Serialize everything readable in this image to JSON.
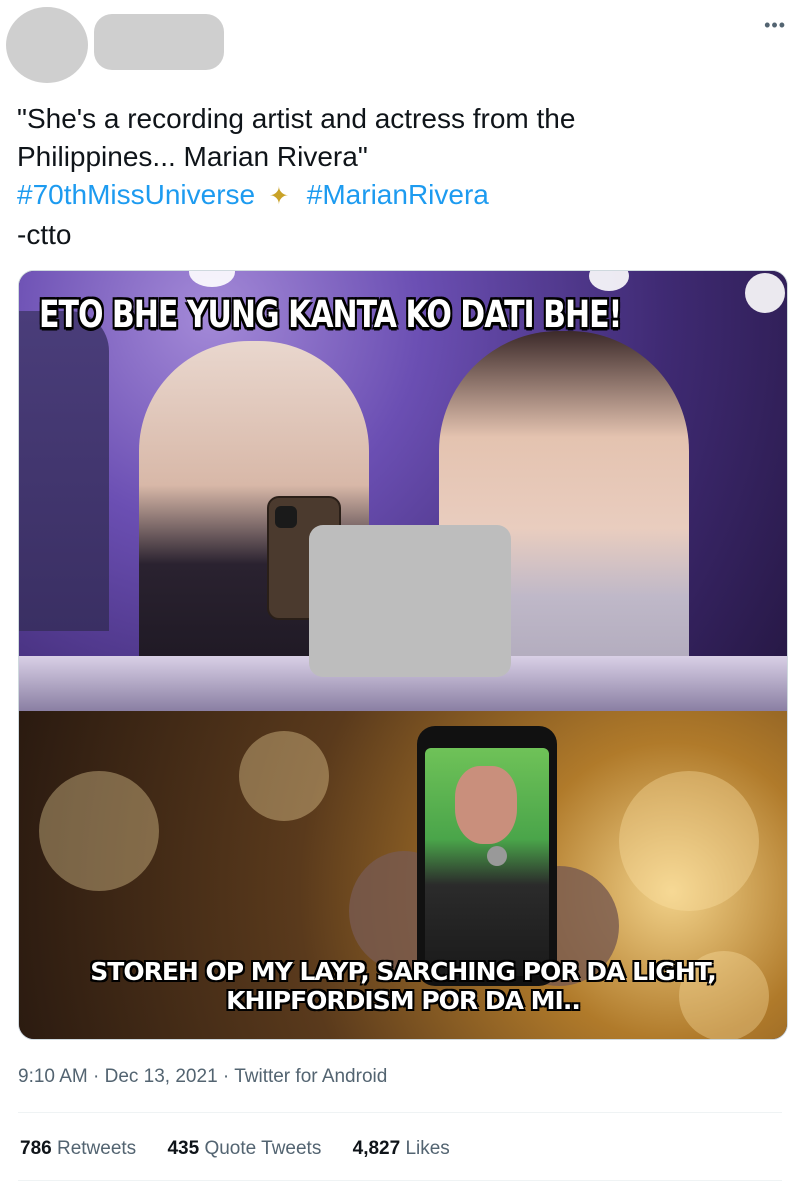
{
  "tweet": {
    "text_lines": [
      "\"She's a recording artist and actress from the",
      "Philippines... Marian Rivera\""
    ],
    "hashtags": [
      "#70thMissUniverse",
      "#MarianRivera"
    ],
    "sparkle": "✦",
    "closing_line": "-ctto"
  },
  "header": {
    "more_icon": "•••"
  },
  "media": {
    "top_caption": "ETO BHE YUNG KANTA KO DATI BHE!",
    "bottom_caption_lines": [
      "STOREH OP MY LAYP, SARCHING POR DA LIGHT,",
      "KHIPFORDISM POR DA MI.."
    ]
  },
  "meta": {
    "time": "9:10 AM",
    "separator": "·",
    "date": "Dec 13, 2021",
    "source": "Twitter for Android"
  },
  "stats": {
    "retweets_count": "786",
    "retweets_label": "Retweets",
    "quotes_count": "435",
    "quotes_label": "Quote Tweets",
    "likes_count": "4,827",
    "likes_label": "Likes"
  },
  "colors": {
    "link": "#1d9bf0",
    "secondary_text": "#536471",
    "primary_text": "#0f1419",
    "redaction": "#cfcfcf"
  }
}
